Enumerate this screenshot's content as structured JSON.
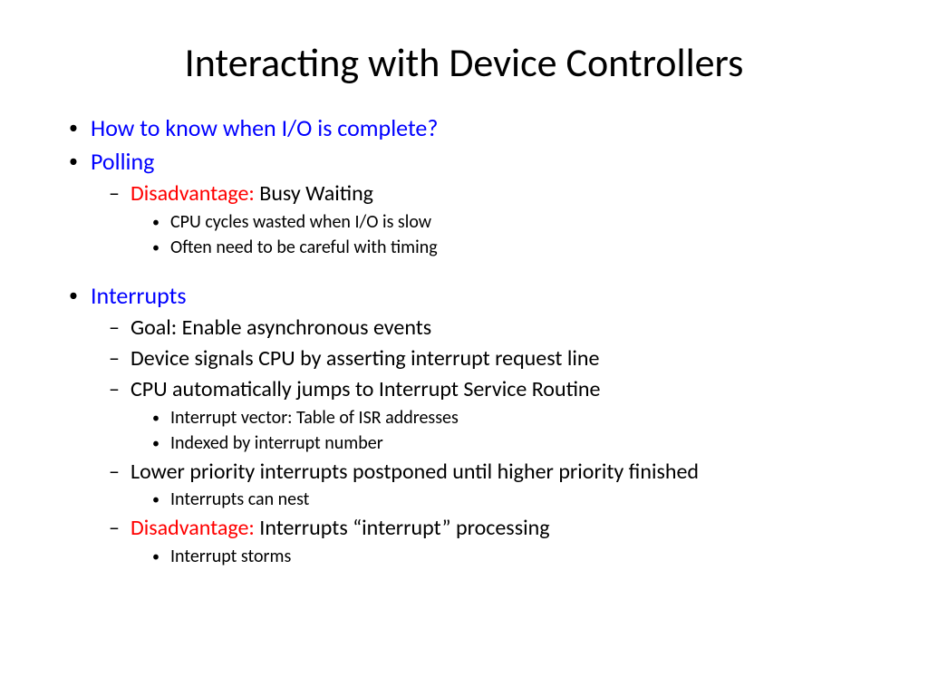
{
  "title": "Interacting with Device Controllers",
  "b1": "How to know when I/O is complete?",
  "b2": "Polling",
  "b2_1_red": "Disadvantage:",
  "b2_1_rest": " Busy Waiting",
  "b2_1_1": "CPU cycles wasted when I/O is slow",
  "b2_1_2": "Often need to be careful with timing",
  "b3": "Interrupts",
  "b3_1": "Goal: Enable asynchronous events",
  "b3_2": "Device signals CPU by asserting interrupt request line",
  "b3_3": "CPU automatically jumps to Interrupt Service Routine",
  "b3_3_1": "Interrupt vector: Table of ISR addresses",
  "b3_3_2": "Indexed by interrupt number",
  "b3_4": "Lower priority interrupts postponed until higher priority finished",
  "b3_4_1": "Interrupts can nest",
  "b3_5_red": "Disadvantage:",
  "b3_5_rest": " Interrupts “interrupt” processing",
  "b3_5_1": "Interrupt storms"
}
